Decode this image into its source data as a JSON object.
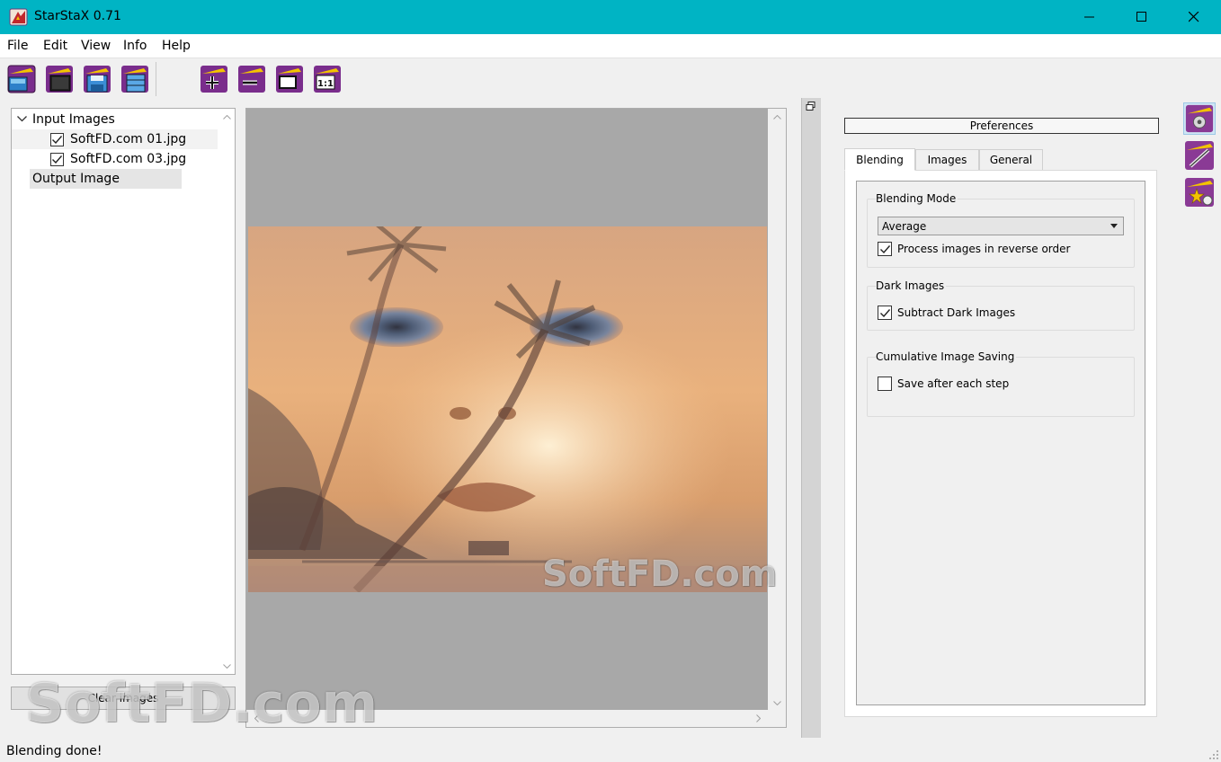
{
  "window": {
    "title": "StarStaX 0.71",
    "icons": [
      "app-icon",
      "minimize-icon",
      "maximize-icon",
      "close-icon"
    ]
  },
  "menu": [
    "File",
    "Edit",
    "View",
    "Info",
    "Help"
  ],
  "toolbar": {
    "buttons": [
      "open-images-icon",
      "open-dark-images-icon",
      "save-image-icon",
      "export-icon",
      "zoom-in-icon",
      "zoom-out-icon",
      "fit-to-window-icon",
      "actual-size-icon"
    ]
  },
  "tree": {
    "root": "Input Images",
    "items": [
      {
        "label": "SoftFD.com 01.jpg",
        "checked": true
      },
      {
        "label": "SoftFD.com 03.jpg",
        "checked": true
      }
    ],
    "output": "Output Image"
  },
  "clear_button": "Clear images",
  "preferences": {
    "title": "Preferences",
    "tabs": [
      "Blending",
      "Images",
      "General"
    ],
    "active_tab": "Blending",
    "blending_mode": {
      "title": "Blending Mode",
      "selected": "Average",
      "reverse_label": "Process images in reverse order",
      "reverse_checked": true
    },
    "dark_images": {
      "title": "Dark Images",
      "subtract_label": "Subtract Dark Images",
      "subtract_checked": true
    },
    "cumulative": {
      "title": "Cumulative Image Saving",
      "save_label": "Save after each step",
      "save_checked": false
    }
  },
  "side_buttons": [
    "blend-start-icon",
    "settings-wand-icon",
    "star-trail-icon"
  ],
  "status": "Blending done!",
  "watermarks": [
    "SoftFD.com",
    "SoftFD.com"
  ],
  "colors": {
    "titlebar": "#00b4c4",
    "viewer_bg": "#a8a8a8"
  }
}
